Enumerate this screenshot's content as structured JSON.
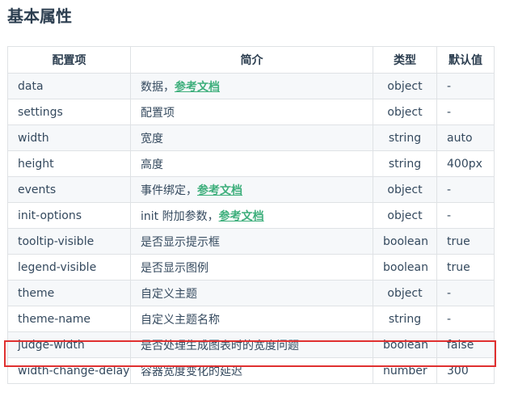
{
  "title": "基本属性",
  "headers": [
    "配置项",
    "简介",
    "类型",
    "默认值"
  ],
  "rows": [
    {
      "name": "data",
      "desc": "数据，",
      "link": "参考文档",
      "type": "object",
      "default": "-"
    },
    {
      "name": "settings",
      "desc": "配置项",
      "type": "object",
      "default": "-"
    },
    {
      "name": "width",
      "desc": "宽度",
      "type": "string",
      "default": "auto"
    },
    {
      "name": "height",
      "desc": "高度",
      "type": "string",
      "default": "400px"
    },
    {
      "name": "events",
      "desc": "事件绑定，",
      "link": "参考文档",
      "type": "object",
      "default": "-"
    },
    {
      "name": "init-options",
      "desc": "init 附加参数，",
      "link": "参考文档",
      "type": "object",
      "default": "-"
    },
    {
      "name": "tooltip-visible",
      "desc": "是否显示提示框",
      "type": "boolean",
      "default": "true"
    },
    {
      "name": "legend-visible",
      "desc": "是否显示图例",
      "type": "boolean",
      "default": "true"
    },
    {
      "name": "theme",
      "desc": "自定义主题",
      "type": "object",
      "default": "-"
    },
    {
      "name": "theme-name",
      "desc": "自定义主题名称",
      "type": "string",
      "default": "-"
    },
    {
      "name": "judge-width",
      "desc": "是否处理生成图表时的宽度问题",
      "type": "boolean",
      "default": "false"
    },
    {
      "name": "width-change-delay",
      "desc": "容器宽度变化的延迟",
      "type": "number",
      "default": "300"
    }
  ],
  "highlight_color": "#e03030",
  "link_color": "#3eaf7c"
}
